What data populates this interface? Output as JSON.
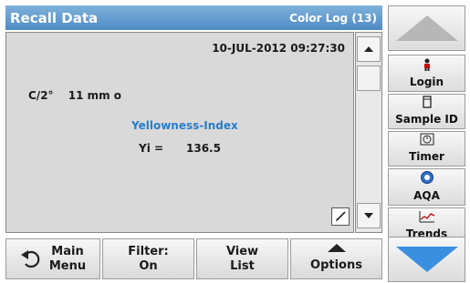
{
  "header": {
    "title": "Recall Data",
    "subtitle": "Color Log (13)"
  },
  "panel": {
    "datetime": "10-JUL-2012  09:27:30",
    "c2_label": "C/2°",
    "c2_value": "11 mm o",
    "parameter": "Yellowness-Index",
    "yi_label": "Yi =",
    "yi_value": "136.5"
  },
  "right": {
    "login": "Login",
    "sample_id": "Sample ID",
    "timer": "Timer",
    "aqa": "AQA",
    "trends": "Trends"
  },
  "bottom": {
    "main_menu_1": "Main",
    "main_menu_2": "Menu",
    "filter_1": "Filter:",
    "filter_2": "On",
    "view_1": "View",
    "view_2": "List",
    "options": "Options"
  },
  "icons": {
    "login": "person-icon",
    "sample_id": "sample-cup-icon",
    "timer": "timer-icon",
    "aqa": "aqa-icon",
    "trends": "trend-chart-icon"
  },
  "colors": {
    "header": "#5b95cc",
    "accent": "#2a7cc9",
    "nav_arrow": "#3b8fe0"
  }
}
